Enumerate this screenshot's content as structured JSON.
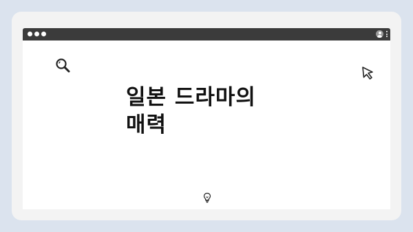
{
  "window": {
    "controls": [
      "close",
      "minimize",
      "maximize"
    ],
    "toolbar_icons": [
      "user-icon",
      "kebab-menu-icon"
    ]
  },
  "slide": {
    "title_line1": "일본 드라마의",
    "title_line2": "매력"
  },
  "icons": {
    "top_decoration": "dots",
    "search": "search-icon",
    "cursor": "cursor-arrow-icon",
    "bulb": "lightbulb-icon"
  },
  "colors": {
    "background": "#dbe3ee",
    "browser_bar": "#3b3b3b",
    "panel": "#ffffff",
    "text": "#111111"
  }
}
